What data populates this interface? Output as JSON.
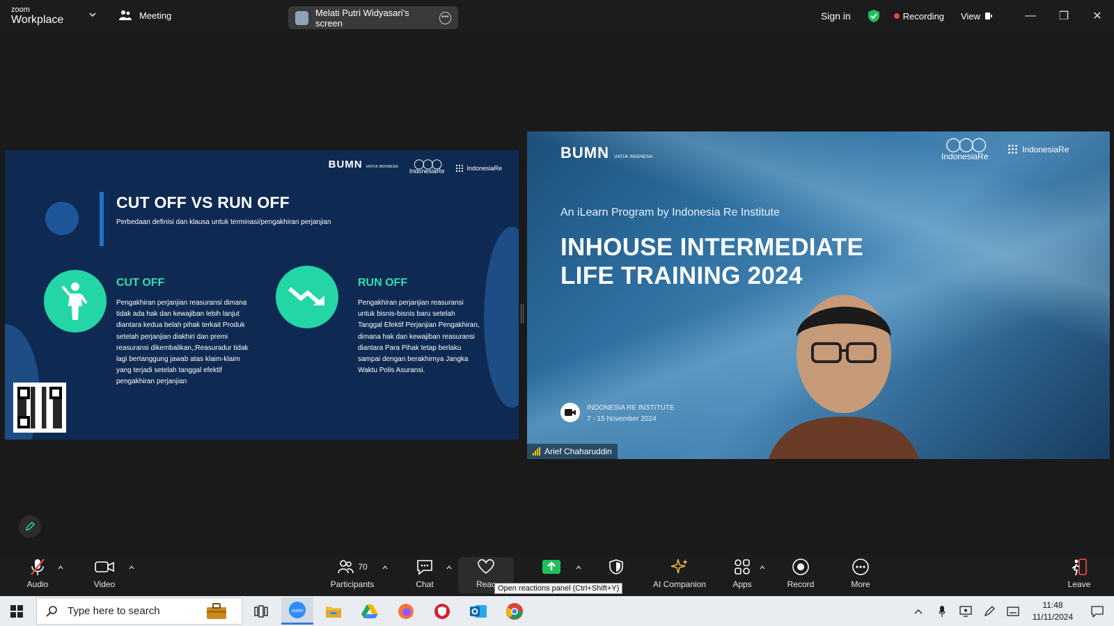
{
  "app": {
    "brand_top": "zoom",
    "brand_bottom": "Workplace",
    "meeting_label": "Meeting",
    "share_label": "Melati Putri Widyasari's screen",
    "sign_in": "Sign in",
    "recording": "Recording",
    "view": "View"
  },
  "slide": {
    "logo_bumn": "BUMN",
    "logo_bumn_small": "UNTUK INDONESIA",
    "logo_ire": "IndonesiaRe",
    "logo_iri": "IndonesiaRe",
    "title": "CUT OFF VS RUN OFF",
    "subtitle": "Perbedaan definisi dan klausa untuk terminasi/pengakhiran perjanjian",
    "cut_off": {
      "heading": "CUT OFF",
      "lines": [
        "Pengakhiran perjanjian reasuransi dimana",
        "tidak ada hak dan kewajiban lebih lanjut",
        "diantara kedua belah pihak terkait Produk",
        "setelah perjanjian diakhiri dan premi",
        "reasuransi dikembalikan,;Reasuradur tidak",
        "lagi bertanggung jawab atas klaim-klaim",
        "yang terjadi setelah tanggal efektif",
        "pengakhiran perjanjian"
      ]
    },
    "run_off": {
      "heading": "RUN OFF",
      "lines": [
        "Pengakhiran perjanjian reasuransi",
        "untuk bisnis-bisnis baru setelah",
        "Tanggal Efektif Perjanjian Pengakhiran,",
        "dimana hak dan kewajiban reasuransi",
        "diantara Para Pihak tetap berlaku",
        "sampai dengan berakhirnya Jangka",
        "Waktu Polis Asuransi."
      ]
    }
  },
  "video": {
    "logo_bumn": "BUMN",
    "logo_bumn_small": "UNTUK INDONESIA",
    "logo_ire": "IndonesiaRe",
    "logo_iri": "IndonesiaRe",
    "tagline": "An iLearn Program by Indonesia Re Institute",
    "headline_1": "INHOUSE INTERMEDIATE",
    "headline_2": "LIFE TRAINING 2024",
    "org": "INDONESIA RE INSTITUTE",
    "dates": "7 - 15 November 2024",
    "participant_name": "Arief Chaharuddin"
  },
  "toolbar": {
    "audio": "Audio",
    "video": "Video",
    "participants": "Participants",
    "participants_count": "70",
    "chat": "Chat",
    "reactions": "Reac",
    "ai_companion": "AI Companion",
    "apps": "Apps",
    "record": "Record",
    "more": "More",
    "leave": "Leave",
    "tooltip": "Open reactions panel (Ctrl+Shift+Y)"
  },
  "taskbar": {
    "search_placeholder": "Type here to search",
    "time": "11:48",
    "date": "11/11/2024"
  },
  "colors": {
    "accent_green": "#24d6a6",
    "record_red": "#e8453c",
    "slide_bg": "#0f2a52",
    "share_green": "#1ec05a"
  }
}
